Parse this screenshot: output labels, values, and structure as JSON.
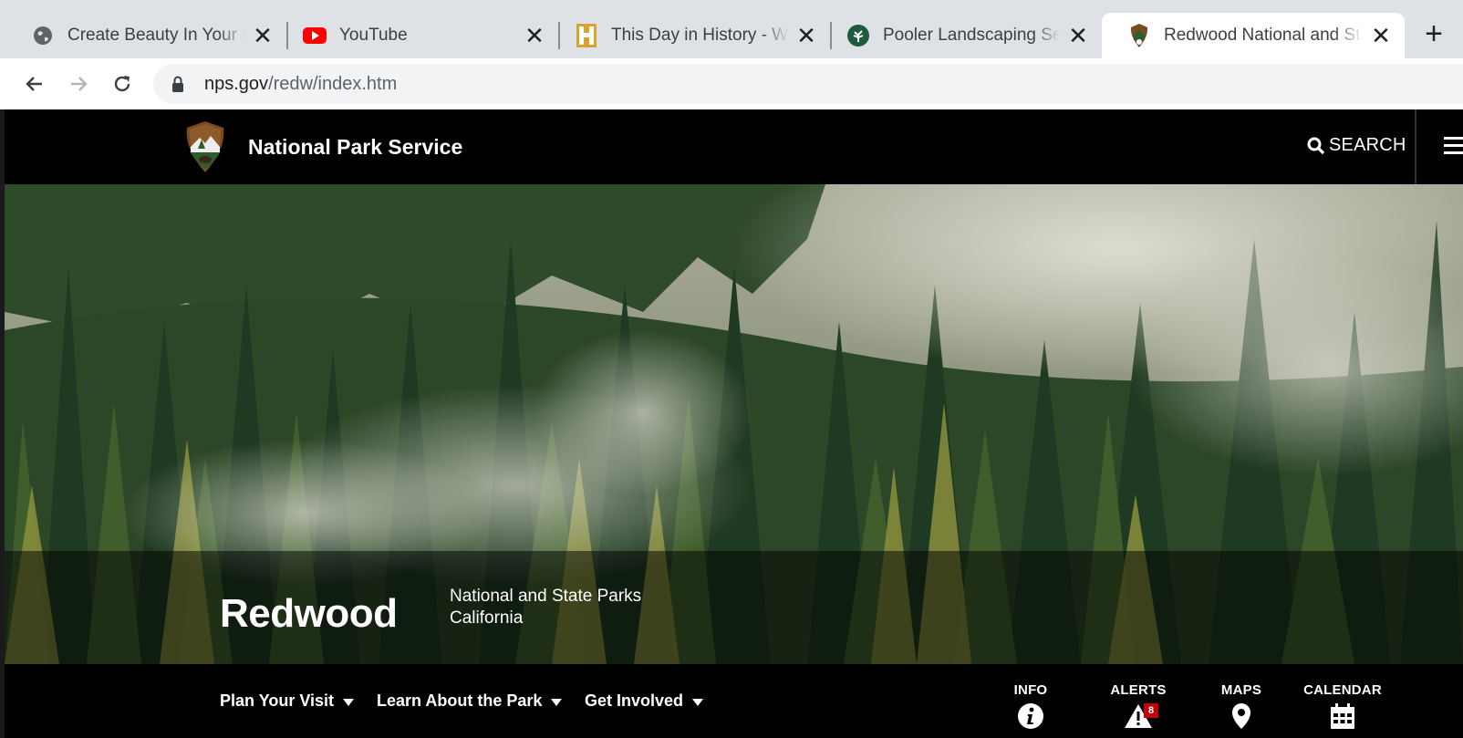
{
  "browser": {
    "tabs": [
      {
        "title": "Create Beauty In Your life",
        "icon": "globe-icon"
      },
      {
        "title": "YouTube",
        "icon": "youtube-icon"
      },
      {
        "title": "This Day in History - What",
        "icon": "history-h-icon"
      },
      {
        "title": "Pooler Landscaping Servic",
        "icon": "tree-icon"
      },
      {
        "title": "Redwood National and Sta",
        "icon": "nps-arrowhead-icon",
        "active": true
      }
    ],
    "close_glyph": "✕",
    "new_tab_glyph": "+",
    "url_host": "nps.gov",
    "url_path": "/redw/index.htm"
  },
  "nps": {
    "agency_name": "National Park Service",
    "search_label": "SEARCH"
  },
  "park": {
    "name": "Redwood",
    "designation": "National and State Parks",
    "state": "California"
  },
  "park_nav": {
    "menus": [
      {
        "label": "Plan Your Visit"
      },
      {
        "label": "Learn About the Park"
      },
      {
        "label": "Get Involved"
      }
    ],
    "quick_links": [
      {
        "label": "INFO",
        "icon": "info-icon"
      },
      {
        "label": "ALERTS",
        "icon": "alert-icon",
        "badge": "8"
      },
      {
        "label": "MAPS",
        "icon": "map-pin-icon"
      },
      {
        "label": "CALENDAR",
        "icon": "calendar-icon"
      }
    ]
  },
  "colors": {
    "chrome_bg": "#dee1e6",
    "header_bg": "#000000",
    "alert_badge": "#c2000b",
    "forest_dark": "#1f3a22",
    "forest_light": "#8a8f3c"
  }
}
